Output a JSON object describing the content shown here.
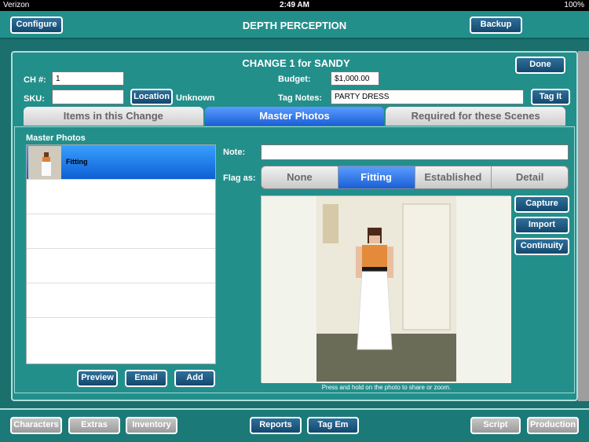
{
  "status": {
    "carrier": "Verizon",
    "time": "2:49 AM",
    "battery": "100%"
  },
  "app": {
    "title": "DEPTH PERCEPTION",
    "configure": "Configure",
    "backup": "Backup"
  },
  "modal": {
    "title": "CHANGE 1 for SANDY",
    "done": "Done",
    "ch_label": "CH #:",
    "ch_value": "1",
    "budget_label": "Budget:",
    "budget_value": "$1,000.00",
    "sku_label": "SKU:",
    "sku_value": "",
    "location_btn": "Location",
    "location_value": "Unknown",
    "tagnotes_label": "Tag Notes:",
    "tagnotes_value": "PARTY DRESS",
    "tagit": "Tag It"
  },
  "tabs": [
    {
      "label": "Items in this Change",
      "active": false
    },
    {
      "label": "Master Photos",
      "active": true
    },
    {
      "label": "Required for these Scenes",
      "active": false
    }
  ],
  "master": {
    "header": "Master Photos",
    "items": [
      {
        "label": "Fitting",
        "selected": true
      }
    ],
    "preview": "Preview",
    "email": "Email",
    "add": "Add"
  },
  "details": {
    "note_label": "Note:",
    "note_value": "",
    "flag_label": "Flag as:",
    "flags": [
      "None",
      "Fitting",
      "Established",
      "Detail"
    ],
    "flag_selected": "Fitting",
    "capture": "Capture",
    "import": "Import",
    "continuity": "Continuity",
    "photo_hint": "Press and hold on the photo to share or zoom."
  },
  "bottom": {
    "characters": "Characters",
    "extras": "Extras",
    "inventory": "Inventory",
    "reports": "Reports",
    "tagem": "Tag Em",
    "script": "Script",
    "production": "Production"
  }
}
